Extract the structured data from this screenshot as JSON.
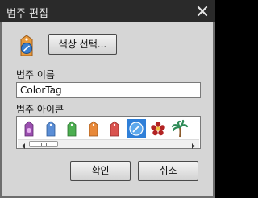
{
  "dialog": {
    "title": "범주 편집",
    "close_icon": "close-icon"
  },
  "preview": {
    "icon": "blue-tag-icon",
    "color": "#3a7fd0"
  },
  "color_button": {
    "label": "색상 선택..."
  },
  "name": {
    "label": "범주 이름",
    "value": "ColorTag"
  },
  "icons": {
    "label": "범주 아이콘",
    "items": [
      {
        "name": "purple-flower-tag-icon",
        "color": "#9b4fb0",
        "selected": false
      },
      {
        "name": "blue-tag-icon",
        "color": "#5b8ed6",
        "selected": false
      },
      {
        "name": "green-tag-icon",
        "color": "#4caf50",
        "selected": false
      },
      {
        "name": "orange-tag-icon",
        "color": "#e8893a",
        "selected": false
      },
      {
        "name": "red-tag-icon",
        "color": "#d9534f",
        "selected": false
      },
      {
        "name": "blue-circle-tag-icon",
        "color": "#3a7fd0",
        "selected": true
      },
      {
        "name": "flower-icon",
        "color": "#b22222",
        "selected": false
      },
      {
        "name": "palm-tree-icon",
        "color": "#2e8b57",
        "selected": false
      }
    ]
  },
  "buttons": {
    "ok": "확인",
    "cancel": "취소"
  }
}
